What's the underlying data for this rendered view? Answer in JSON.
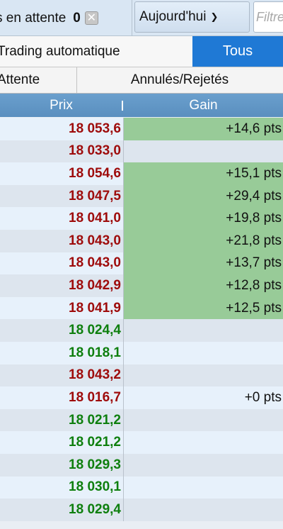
{
  "toolbar": {
    "pending_label": "s en attente",
    "pending_count": "0",
    "clear_icon": "x-icon",
    "date_filter": "Aujourd'hui",
    "filter_placeholder": "Filtrer"
  },
  "tabs_row": {
    "auto_label": "Trading automatique",
    "all_label": "Tous"
  },
  "subtabs": {
    "pending_label": "Attente",
    "cancelled_label": "Annulés/Rejetés"
  },
  "columns": {
    "price": "Prix",
    "gain": "Gain"
  },
  "colors": {
    "price_red": "#9e0b0b",
    "price_green": "#0e7f0e",
    "gain_positive_bg": "#98cb98",
    "active_tab": "#1f79d5"
  },
  "rows": [
    {
      "price": "18 053,6",
      "color": "red",
      "gain": "+14,6 pts",
      "highlight": true
    },
    {
      "price": "18 033,0",
      "color": "red",
      "gain": "",
      "highlight": false
    },
    {
      "price": "18 054,6",
      "color": "red",
      "gain": "+15,1 pts",
      "highlight": true
    },
    {
      "price": "18 047,5",
      "color": "red",
      "gain": "+29,4 pts",
      "highlight": true
    },
    {
      "price": "18 041,0",
      "color": "red",
      "gain": "+19,8 pts",
      "highlight": true
    },
    {
      "price": "18 043,0",
      "color": "red",
      "gain": "+21,8 pts",
      "highlight": true
    },
    {
      "price": "18 043,0",
      "color": "red",
      "gain": "+13,7 pts",
      "highlight": true
    },
    {
      "price": "18 042,9",
      "color": "red",
      "gain": "+12,8 pts",
      "highlight": true
    },
    {
      "price": "18 041,9",
      "color": "red",
      "gain": "+12,5 pts",
      "highlight": true
    },
    {
      "price": "18 024,4",
      "color": "green",
      "gain": "",
      "highlight": false
    },
    {
      "price": "18 018,1",
      "color": "green",
      "gain": "",
      "highlight": false
    },
    {
      "price": "18 043,2",
      "color": "red",
      "gain": "",
      "highlight": false
    },
    {
      "price": "18 016,7",
      "color": "red",
      "gain": "+0 pts",
      "highlight": false
    },
    {
      "price": "18 021,2",
      "color": "green",
      "gain": "",
      "highlight": false
    },
    {
      "price": "18 021,2",
      "color": "green",
      "gain": "",
      "highlight": false
    },
    {
      "price": "18 029,3",
      "color": "green",
      "gain": "",
      "highlight": false
    },
    {
      "price": "18 030,1",
      "color": "green",
      "gain": "",
      "highlight": false
    },
    {
      "price": "18 029,4",
      "color": "green",
      "gain": "",
      "highlight": false
    }
  ]
}
